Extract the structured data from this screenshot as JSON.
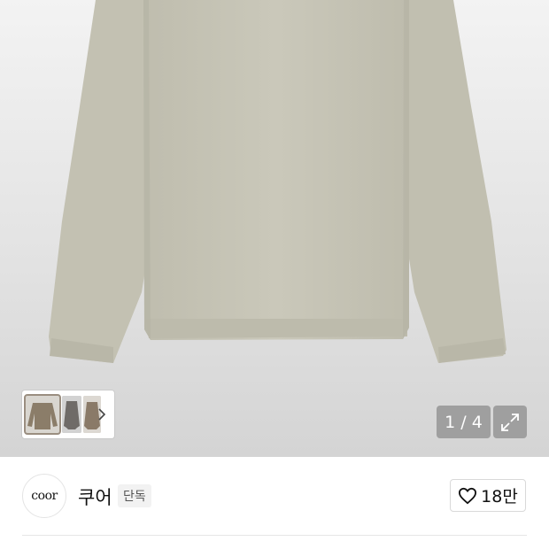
{
  "gallery": {
    "current_page": "1",
    "total_pages": "4",
    "counter_text": "1 / 4",
    "thumbnail_count": 3,
    "product_color": "#c8c6b8"
  },
  "brand": {
    "logo_text": "coor",
    "name": "쿠어",
    "badge": "단독"
  },
  "like": {
    "count_label": "18만",
    "icon": "heart-outline-icon"
  },
  "icons": {
    "next": "chevron-right-icon",
    "expand": "expand-icon"
  }
}
